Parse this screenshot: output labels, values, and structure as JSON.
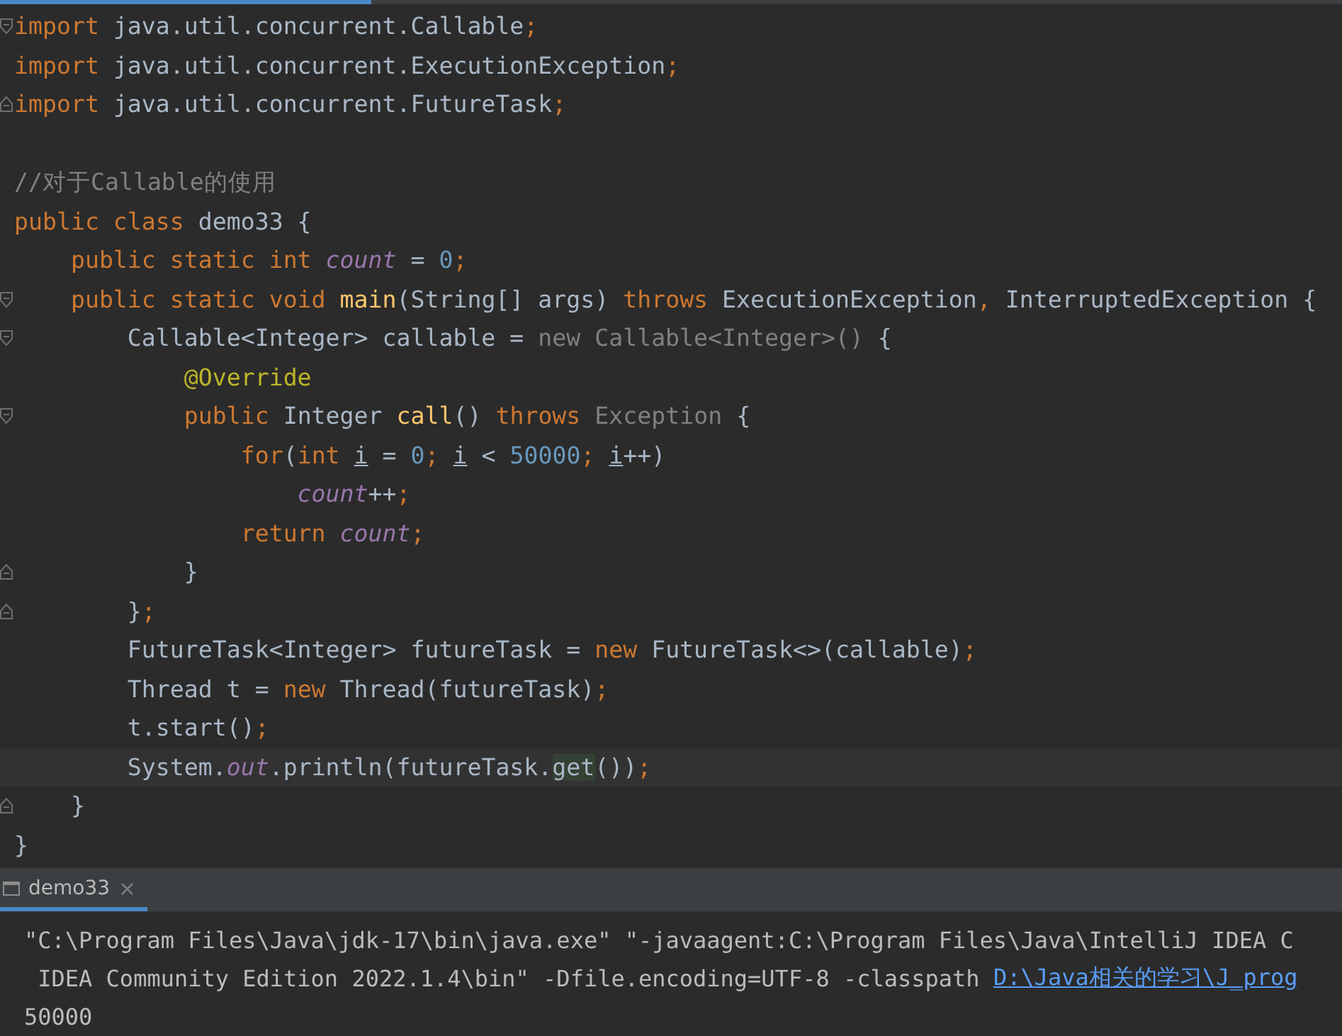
{
  "editor": {
    "lines": [
      {
        "fold_start": true,
        "fold_end": false,
        "tokens": [
          {
            "kind": "kw",
            "text": "import "
          },
          {
            "kind": "plain",
            "text": "java.util.concurrent.Callable"
          },
          {
            "kind": "punct",
            "text": ";"
          }
        ]
      },
      {
        "fold_start": false,
        "fold_end": false,
        "tokens": [
          {
            "kind": "kw",
            "text": "import "
          },
          {
            "kind": "plain",
            "text": "java.util.concurrent.ExecutionException"
          },
          {
            "kind": "punct",
            "text": ";"
          }
        ]
      },
      {
        "fold_start": false,
        "fold_end": true,
        "tokens": [
          {
            "kind": "kw",
            "text": "import "
          },
          {
            "kind": "plain",
            "text": "java.util.concurrent.FutureTask"
          },
          {
            "kind": "punct",
            "text": ";"
          }
        ]
      },
      {
        "fold_start": false,
        "fold_end": false
      },
      {
        "fold_start": false,
        "fold_end": false,
        "tokens": [
          {
            "kind": "comment",
            "text": "//对于Callable的使用"
          }
        ]
      },
      {
        "fold_start": false,
        "fold_end": false,
        "tokens": [
          {
            "kind": "kw",
            "text": "public class "
          },
          {
            "kind": "plain",
            "text": "demo33 {"
          }
        ]
      },
      {
        "fold_start": false,
        "fold_end": false,
        "tokens": [
          {
            "kind": "kw",
            "text": "    public static int "
          },
          {
            "kind": "field",
            "text": "count"
          },
          {
            "kind": "plain",
            "text": " = "
          },
          {
            "kind": "num",
            "text": "0"
          },
          {
            "kind": "punct",
            "text": ";"
          }
        ]
      },
      {
        "fold_start": true,
        "fold_end": false,
        "tokens": [
          {
            "kind": "kw",
            "text": "    public static void "
          },
          {
            "kind": "method",
            "text": "main"
          },
          {
            "kind": "plain",
            "text": "(String[] args) "
          },
          {
            "kind": "kw",
            "text": "throws "
          },
          {
            "kind": "plain",
            "text": "ExecutionException"
          },
          {
            "kind": "punct",
            "text": ", "
          },
          {
            "kind": "plain",
            "text": "InterruptedException {"
          }
        ]
      },
      {
        "fold_start": true,
        "fold_end": false,
        "tokens": [
          {
            "kind": "plain",
            "text": "        Callable<Integer> callable = "
          },
          {
            "kind": "dim",
            "text": "new Callable<Integer>()"
          },
          {
            "kind": "plain",
            "text": " {"
          }
        ]
      },
      {
        "fold_start": false,
        "fold_end": false,
        "tokens": [
          {
            "kind": "annotation",
            "text": "            @Override"
          }
        ]
      },
      {
        "fold_start": true,
        "fold_end": false,
        "tokens": [
          {
            "kind": "kw",
            "text": "            public "
          },
          {
            "kind": "plain",
            "text": "Integer "
          },
          {
            "kind": "method",
            "text": "call"
          },
          {
            "kind": "plain",
            "text": "() "
          },
          {
            "kind": "kw",
            "text": "throws "
          },
          {
            "kind": "dim",
            "text": "Exception"
          },
          {
            "kind": "plain",
            "text": " {"
          }
        ]
      },
      {
        "fold_start": false,
        "fold_end": false,
        "tokens": [
          {
            "kind": "kw",
            "text": "                for"
          },
          {
            "kind": "plain",
            "text": "("
          },
          {
            "kind": "kw",
            "text": "int "
          },
          {
            "kind": "var",
            "text": "i"
          },
          {
            "kind": "plain",
            "text": " = "
          },
          {
            "kind": "num",
            "text": "0"
          },
          {
            "kind": "punct",
            "text": "; "
          },
          {
            "kind": "var",
            "text": "i"
          },
          {
            "kind": "plain",
            "text": " < "
          },
          {
            "kind": "num",
            "text": "50000"
          },
          {
            "kind": "punct",
            "text": "; "
          },
          {
            "kind": "var",
            "text": "i"
          },
          {
            "kind": "plain",
            "text": "++)"
          }
        ]
      },
      {
        "fold_start": false,
        "fold_end": false,
        "tokens": [
          {
            "kind": "field",
            "text": "                    count"
          },
          {
            "kind": "plain",
            "text": "++"
          },
          {
            "kind": "punct",
            "text": ";"
          }
        ]
      },
      {
        "fold_start": false,
        "fold_end": false,
        "tokens": [
          {
            "kind": "kw",
            "text": "                return "
          },
          {
            "kind": "field",
            "text": "count"
          },
          {
            "kind": "punct",
            "text": ";"
          }
        ]
      },
      {
        "fold_start": false,
        "fold_end": true,
        "tokens": [
          {
            "kind": "plain",
            "text": "            }"
          }
        ]
      },
      {
        "fold_start": false,
        "fold_end": true,
        "tokens": [
          {
            "kind": "plain",
            "text": "        }"
          },
          {
            "kind": "punct",
            "text": ";"
          }
        ]
      },
      {
        "fold_start": false,
        "fold_end": false,
        "tokens": [
          {
            "kind": "plain",
            "text": "        FutureTask<Integer> futureTask = "
          },
          {
            "kind": "kw",
            "text": "new "
          },
          {
            "kind": "plain",
            "text": "FutureTask<>(callable)"
          },
          {
            "kind": "punct",
            "text": ";"
          }
        ]
      },
      {
        "fold_start": false,
        "fold_end": false,
        "tokens": [
          {
            "kind": "plain",
            "text": "        Thread t = "
          },
          {
            "kind": "kw",
            "text": "new "
          },
          {
            "kind": "plain",
            "text": "Thread(futureTask)"
          },
          {
            "kind": "punct",
            "text": ";"
          }
        ]
      },
      {
        "fold_start": false,
        "fold_end": false,
        "tokens": [
          {
            "kind": "plain",
            "text": "        t.start()"
          },
          {
            "kind": "punct",
            "text": ";"
          }
        ]
      },
      {
        "fold_start": false,
        "fold_end": false,
        "current": true,
        "tokens": [
          {
            "kind": "plain",
            "text": "        System."
          },
          {
            "kind": "field",
            "text": "out"
          },
          {
            "kind": "plain",
            "text": ".println(futureTask."
          },
          {
            "kind": "match",
            "text": "get"
          },
          {
            "kind": "plain",
            "text": "())"
          },
          {
            "kind": "punct",
            "text": ";"
          }
        ]
      },
      {
        "fold_start": false,
        "fold_end": true,
        "tokens": [
          {
            "kind": "plain",
            "text": "    }"
          }
        ]
      },
      {
        "fold_start": false,
        "fold_end": false,
        "tokens": [
          {
            "kind": "plain",
            "text": "}"
          }
        ]
      }
    ]
  },
  "run_panel": {
    "tab": {
      "label": "demo33",
      "close": "×",
      "selected": true
    },
    "output": [
      {
        "parts": [
          {
            "kind": "text",
            "text": "\"C:\\Program Files\\Java\\jdk-17\\bin\\java.exe\" \"-javaagent:C:\\Program Files\\Java\\IntelliJ IDEA C"
          }
        ]
      },
      {
        "parts": [
          {
            "kind": "text",
            "text": " IDEA Community Edition 2022.1.4\\bin\" -Dfile.encoding=UTF-8 -classpath "
          },
          {
            "kind": "link",
            "text": "D:\\Java相关的学习\\J_prog"
          }
        ]
      },
      {
        "parts": [
          {
            "kind": "text",
            "text": "50000"
          }
        ]
      }
    ]
  }
}
